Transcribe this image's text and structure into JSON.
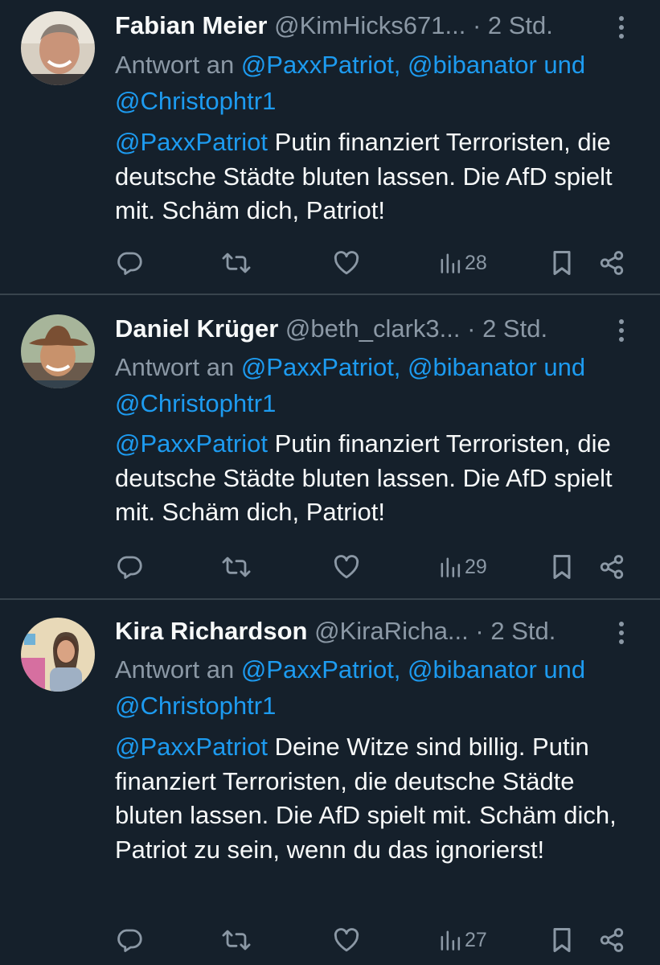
{
  "colors": {
    "background": "#15202b",
    "text": "#f7f9f9",
    "muted": "#8b98a5",
    "mention": "#1d9bf0",
    "divider": "#38444d"
  },
  "tweets": [
    {
      "name": "Fabian Meier",
      "handle": "@KimHicks671...",
      "separator": "·",
      "time": "2 Std.",
      "reply_prefix": "Antwort an",
      "reply_mentions": "@PaxxPatriot, @bibanator",
      "reply_joiner": "und",
      "reply_last": "@Christophtr1",
      "body_mention": "@PaxxPatriot",
      "body_text": " Putin finanziert Terroristen, die deutsche Städte bluten lassen. Die AfD spielt mit. Schäm dich, Patriot!",
      "views": "28",
      "avatar_icon": "avatar-photo"
    },
    {
      "name": "Daniel Krüger",
      "handle": "@beth_clark3...",
      "separator": "·",
      "time": "2 Std.",
      "reply_prefix": "Antwort an",
      "reply_mentions": "@PaxxPatriot, @bibanator",
      "reply_joiner": "und",
      "reply_last": "@Christophtr1",
      "body_mention": "@PaxxPatriot",
      "body_text": " Putin finanziert Terroristen, die deutsche Städte bluten lassen. Die AfD spielt mit. Schäm dich, Patriot!",
      "views": "29",
      "avatar_icon": "avatar-photo"
    },
    {
      "name": "Kira Richardson",
      "handle": "@KiraRicha...",
      "separator": "·",
      "time": "2 Std.",
      "reply_prefix": "Antwort an",
      "reply_mentions": "@PaxxPatriot, @bibanator",
      "reply_joiner": "und",
      "reply_last": "@Christophtr1",
      "body_mention": "@PaxxPatriot",
      "body_text": " Deine Witze sind billig. Putin finanziert Terroristen, die deutsche Städte bluten lassen. Die AfD spielt mit. Schäm dich, Patriot zu sein, wenn du das ignorierst!",
      "views": "27",
      "avatar_icon": "avatar-photo"
    }
  ],
  "icons": {
    "reply": "reply-icon",
    "retweet": "retweet-icon",
    "like": "like-icon",
    "views": "views-icon",
    "bookmark": "bookmark-icon",
    "share": "share-icon",
    "more": "more-icon"
  }
}
